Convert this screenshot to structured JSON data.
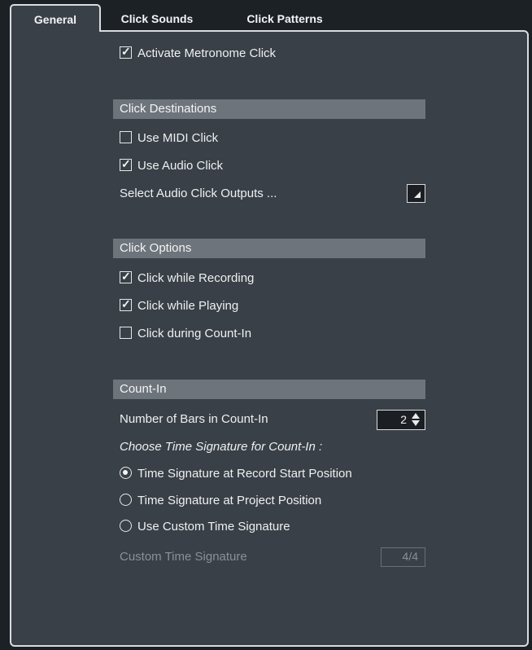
{
  "tabs": [
    {
      "label": "General",
      "active": true
    },
    {
      "label": "Click Sounds",
      "active": false
    },
    {
      "label": "Click Patterns",
      "active": false
    }
  ],
  "activate_metronome": {
    "label": "Activate Metronome Click",
    "checked": true
  },
  "click_destinations": {
    "title": "Click Destinations",
    "use_midi_click": {
      "label": "Use MIDI Click",
      "checked": false
    },
    "use_audio_click": {
      "label": "Use Audio Click",
      "checked": true
    },
    "select_outputs_label": "Select Audio Click Outputs ..."
  },
  "click_options": {
    "title": "Click Options",
    "while_recording": {
      "label": "Click while Recording",
      "checked": true
    },
    "while_playing": {
      "label": "Click while Playing",
      "checked": true
    },
    "during_count_in": {
      "label": "Click during Count-In",
      "checked": false
    }
  },
  "count_in": {
    "title": "Count-In",
    "bars_label": "Number of Bars in Count-In",
    "bars_value": "2",
    "time_sig_heading": "Choose Time Signature for Count-In :",
    "options": [
      {
        "label": "Time Signature at Record Start Position",
        "selected": true
      },
      {
        "label": "Time Signature at Project Position",
        "selected": false
      },
      {
        "label": "Use Custom Time Signature",
        "selected": false
      }
    ],
    "custom_sig_label": "Custom Time Signature",
    "custom_sig_value": "4/4"
  },
  "colors": {
    "panel": "#3a4047",
    "section_header": "#6e747b",
    "frame": "#1c2126"
  }
}
